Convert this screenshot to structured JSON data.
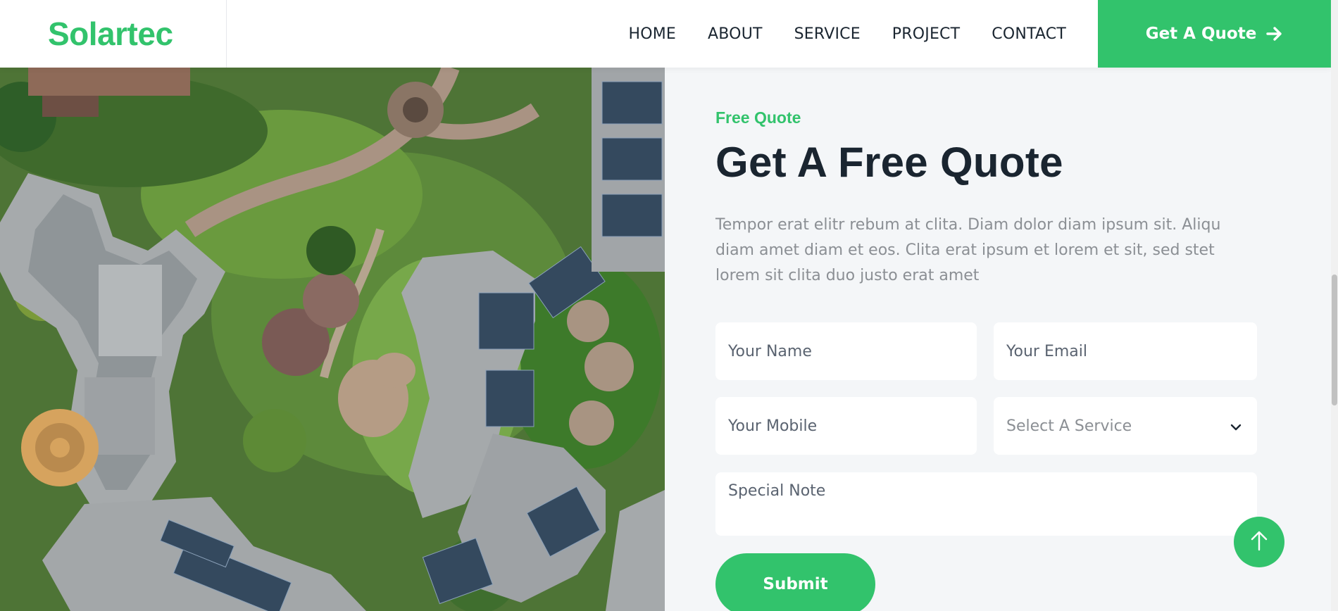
{
  "brand": {
    "name": "Solartec"
  },
  "nav": {
    "items": [
      {
        "label": "HOME"
      },
      {
        "label": "ABOUT"
      },
      {
        "label": "SERVICE"
      },
      {
        "label": "PROJECT"
      },
      {
        "label": "CONTACT"
      }
    ],
    "cta_label": "Get A Quote",
    "cta_icon": "arrow-right-icon"
  },
  "hero_image": {
    "alt": "aerial-view-buildings-solar-panels"
  },
  "quote": {
    "eyebrow": "Free Quote",
    "title": "Get A Free Quote",
    "description": "Tempor erat elitr rebum at clita. Diam dolor diam ipsum sit. Aliqu diam amet diam et eos. Clita erat ipsum et lorem et sit, sed stet lorem sit clita duo justo erat amet",
    "form": {
      "name_placeholder": "Your Name",
      "email_placeholder": "Your Email",
      "mobile_placeholder": "Your Mobile",
      "service_selected": "Select A Service",
      "note_placeholder": "Special Note",
      "submit_label": "Submit"
    }
  },
  "back_to_top": {
    "icon": "arrow-up-icon"
  },
  "colors": {
    "accent": "#32c36c",
    "heading": "#1a2530",
    "muted": "#8b8f94",
    "section_bg": "#f4f6f8"
  }
}
